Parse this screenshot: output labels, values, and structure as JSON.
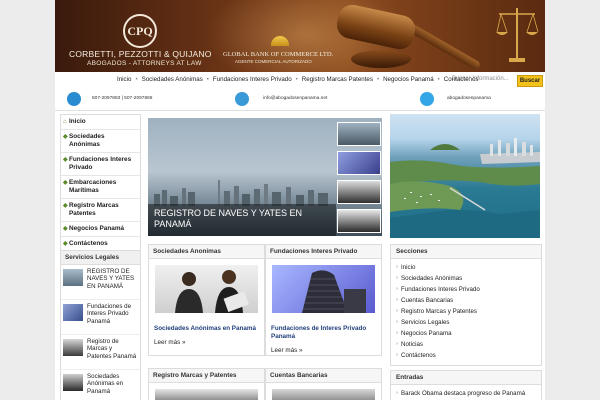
{
  "header": {
    "logo_mark": "CPQ",
    "firm_name": "CORBETTI, PEZZOTTI & QUIJANO",
    "firm_subtitle": "ABOGADOS - ATTORNEYS AT LAW",
    "bank_name": "GLOBAL BANK OF COMMERCE LTD.",
    "bank_subtitle": "AGENTE COMERCIAL AUTORIZADO"
  },
  "nav": {
    "items": [
      "Inicio",
      "Sociedades Anónimas",
      "Fundaciones Interes Privado",
      "Registro Marcas Patentes",
      "Negocios Panamá",
      "Contáctenos"
    ],
    "search_placeholder": "Buscar Información...",
    "search_button": "Buscar"
  },
  "contact": {
    "phones": "507-2097883  |  507-2097866",
    "email": "info@abogadosenpanama.net",
    "skype": "abogadosenpanama"
  },
  "left_menu": {
    "items": [
      "Inicio",
      "Sociedades Anónimas",
      "Fundaciones Interes Privado",
      "Embarcaciones Marítimas",
      "Registro Marcas Patentes",
      "Negocios Panamá",
      "Contáctenos"
    ]
  },
  "services": {
    "title": "Servicios Legales",
    "posts": [
      "REGISTRO DE NAVES Y YATES EN PANAMÁ",
      "Fundaciones de Interes Privado Panamá",
      "Registro de Marcas y Patentes Panamá",
      "Sociedades Anónimas en Panamá"
    ]
  },
  "slider": {
    "caption": "REGISTRO DE NAVES Y YATES EN PANAMÁ"
  },
  "posts": [
    {
      "title": "Sociedades Anonimas",
      "link": "Sociedades Anónimas en Panamá",
      "more": "Leer más »"
    },
    {
      "title": "Fundaciones Interes Privado",
      "link": "Fundaciones de Interes Privado Panamá",
      "more": "Leer más »"
    },
    {
      "title": "Registro Marcas y Patentes"
    },
    {
      "title": "Cuentas Bancarias"
    }
  ],
  "secciones": {
    "title": "Secciones",
    "items": [
      "Inicio",
      "Sociedades Anónimas",
      "Fundaciones Interes Privado",
      "Cuentas Bancarias",
      "Registro Marcas y Patentes",
      "Servicios Legales",
      "Negocios Panama",
      "Noticias",
      "Contáctenos"
    ]
  },
  "entradas": {
    "title": "Entradas",
    "items": [
      "Barack Obama destaca progreso de Panamá"
    ]
  },
  "colors": {
    "header_brown": "#6b3416",
    "link_blue": "#1f3f7a",
    "search_button": "#f2c21a",
    "bullet_green": "#5a8a2a"
  }
}
